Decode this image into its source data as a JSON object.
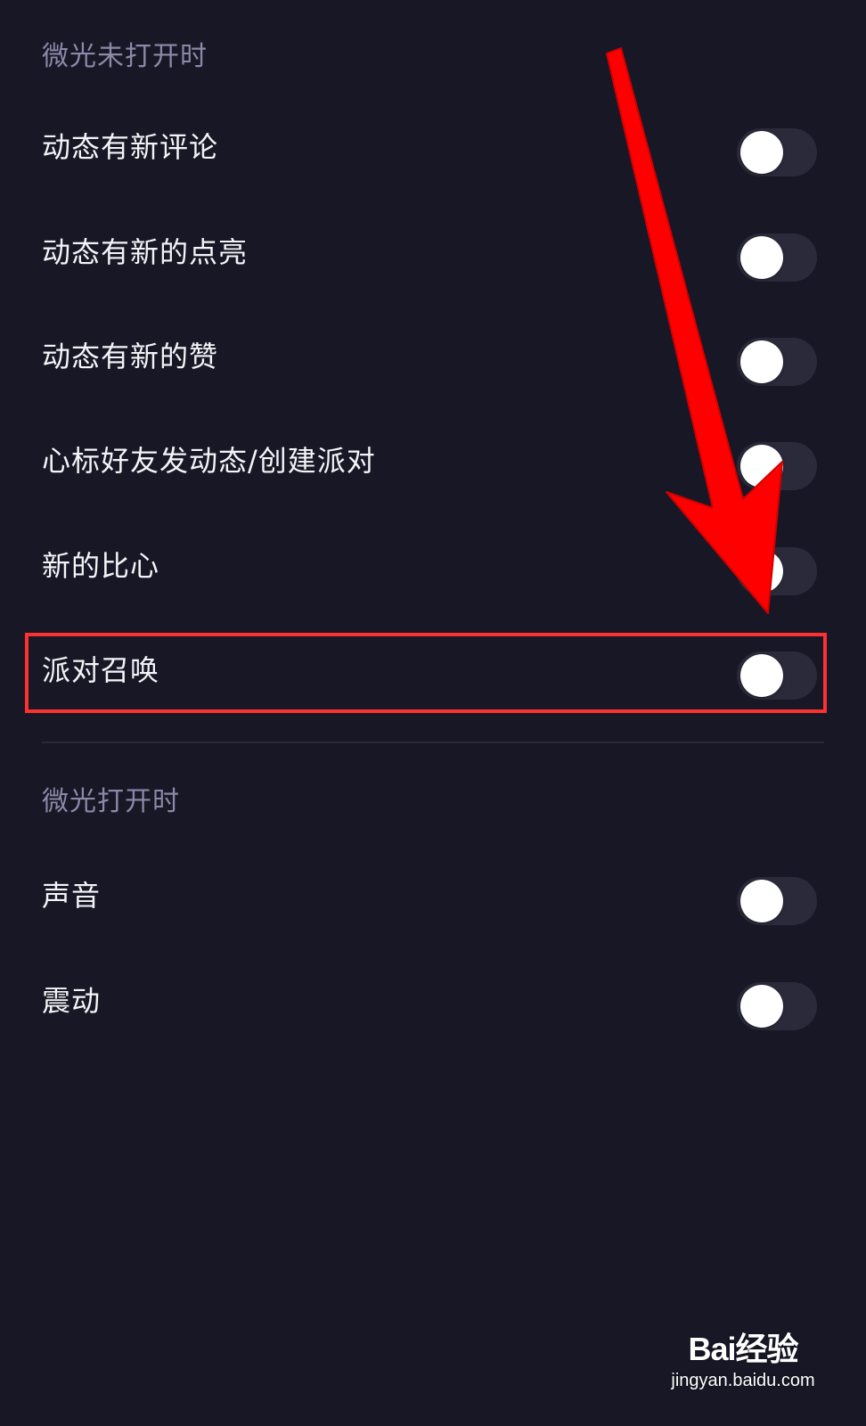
{
  "section_off": {
    "title": "微光未打开时",
    "items": [
      {
        "label": "动态有新评论",
        "enabled": false
      },
      {
        "label": "动态有新的点亮",
        "enabled": false
      },
      {
        "label": "动态有新的赞",
        "enabled": false
      },
      {
        "label": "心标好友发动态/创建派对",
        "enabled": false
      },
      {
        "label": "新的比心",
        "enabled": false
      },
      {
        "label": "派对召唤",
        "enabled": false
      }
    ]
  },
  "section_on": {
    "title": "微光打开时",
    "items": [
      {
        "label": "声音",
        "enabled": false
      },
      {
        "label": "震动",
        "enabled": false
      }
    ]
  },
  "annotation": {
    "highlighted_item": "派对召唤",
    "arrow_color": "#ff0000",
    "box_color": "#ff3030"
  },
  "watermark": {
    "logo": "Bai经验",
    "url": "jingyan.baidu.com"
  },
  "colors": {
    "background": "#181726",
    "section_title": "#8c88a8",
    "toggle_track_off": "#2b2a3a",
    "toggle_knob": "#ffffff"
  }
}
